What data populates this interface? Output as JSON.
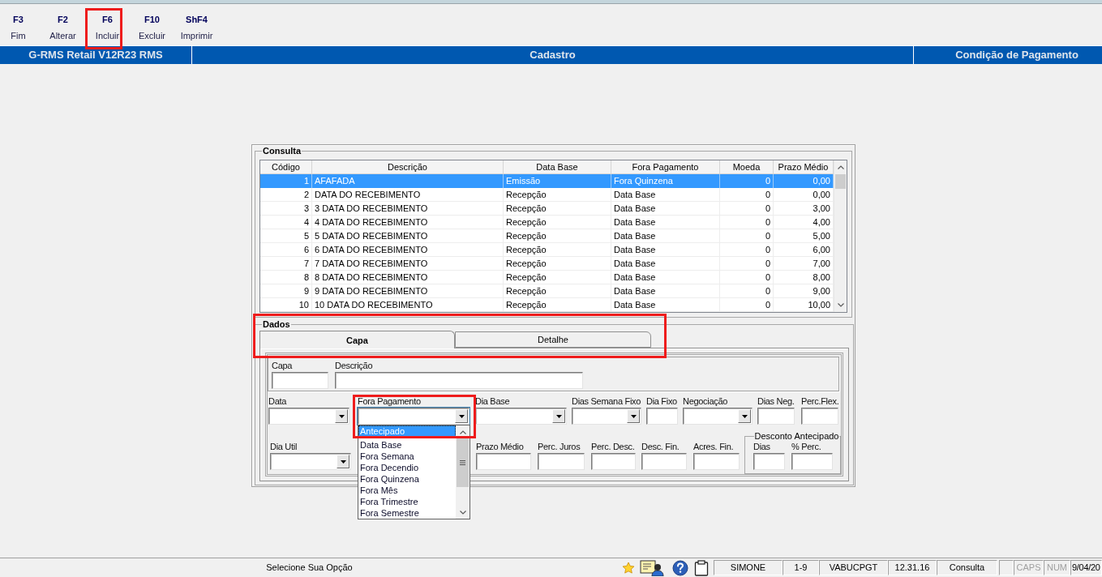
{
  "toolbar": [
    {
      "key": "F3",
      "label": "Fim",
      "highlighted": false
    },
    {
      "key": "F2",
      "label": "Alterar",
      "highlighted": false
    },
    {
      "key": "F6",
      "label": "Incluir",
      "highlighted": true
    },
    {
      "key": "F10",
      "label": "Excluir",
      "highlighted": false
    },
    {
      "key": "ShF4",
      "label": "Imprimir",
      "highlighted": false
    }
  ],
  "header": {
    "app": "G-RMS Retail V12R23 RMS",
    "module": "Cadastro",
    "screen": "Condição de Pagamento"
  },
  "consulta": {
    "title": "Consulta",
    "columns": [
      "Código",
      "Descrição",
      "Data Base",
      "Fora Pagamento",
      "Moeda",
      "Prazo Médio"
    ],
    "rows": [
      {
        "cells": [
          "1",
          "AFAFADA",
          "Emissão",
          "Fora Quinzena",
          "0",
          "0,00"
        ],
        "selected": true
      },
      {
        "cells": [
          "2",
          "DATA DO RECEBIMENTO",
          "Recepção",
          "Data Base",
          "0",
          "0,00"
        ],
        "selected": false
      },
      {
        "cells": [
          "3",
          "3 DATA DO RECEBIMENTO",
          "Recepção",
          "Data Base",
          "0",
          "3,00"
        ],
        "selected": false
      },
      {
        "cells": [
          "4",
          "4 DATA DO RECEBIMENTO",
          "Recepção",
          "Data Base",
          "0",
          "4,00"
        ],
        "selected": false
      },
      {
        "cells": [
          "5",
          "5 DATA DO RECEBIMENTO",
          "Recepção",
          "Data Base",
          "0",
          "5,00"
        ],
        "selected": false
      },
      {
        "cells": [
          "6",
          "6 DATA DO RECEBIMENTO",
          "Recepção",
          "Data Base",
          "0",
          "6,00"
        ],
        "selected": false
      },
      {
        "cells": [
          "7",
          "7 DATA DO RECEBIMENTO",
          "Recepção",
          "Data Base",
          "0",
          "7,00"
        ],
        "selected": false
      },
      {
        "cells": [
          "8",
          "8 DATA DO RECEBIMENTO",
          "Recepção",
          "Data Base",
          "0",
          "8,00"
        ],
        "selected": false
      },
      {
        "cells": [
          "9",
          "9 DATA DO RECEBIMENTO",
          "Recepção",
          "Data Base",
          "0",
          "9,00"
        ],
        "selected": false
      },
      {
        "cells": [
          "10",
          "10 DATA DO RECEBIMENTO",
          "Recepção",
          "Data Base",
          "0",
          "10,00"
        ],
        "selected": false
      }
    ]
  },
  "dados": {
    "title": "Dados",
    "tabs": [
      {
        "label": "Capa",
        "selected": true
      },
      {
        "label": "Detalhe",
        "selected": false
      }
    ],
    "tabs_highlighted": true,
    "capa_fields": [
      {
        "label": "Capa",
        "kind": "text"
      },
      {
        "label": "Descrição",
        "kind": "text"
      }
    ],
    "row_1": [
      {
        "label": "Data",
        "kind": "combo",
        "expanded": false,
        "highlighted": false
      },
      {
        "label": "Fora Pagamento",
        "kind": "combo",
        "expanded": true,
        "highlighted": true,
        "options": [
          {
            "label": "Antecipado",
            "selected": true
          },
          {
            "label": "Data Base",
            "selected": false
          },
          {
            "label": "Fora Semana",
            "selected": false
          },
          {
            "label": "Fora Decendio",
            "selected": false
          },
          {
            "label": "Fora Quinzena",
            "selected": false
          },
          {
            "label": "Fora Mês",
            "selected": false
          },
          {
            "label": "Fora Trimestre",
            "selected": false
          },
          {
            "label": "Fora Semestre",
            "selected": false
          }
        ]
      },
      {
        "label": "Dia Base",
        "kind": "combo",
        "expanded": false,
        "highlighted": false
      },
      {
        "label": "Dias Semana Fixo",
        "kind": "combo",
        "expanded": false,
        "highlighted": false
      },
      {
        "label": "Dia Fixo",
        "kind": "text",
        "highlighted": false
      },
      {
        "label": "Negociação",
        "kind": "combo",
        "expanded": false,
        "highlighted": false
      },
      {
        "label": "Dias Neg.",
        "kind": "text",
        "highlighted": false
      },
      {
        "label": "Perc.Flex.",
        "kind": "text",
        "highlighted": false
      }
    ],
    "row_2": [
      {
        "label": "Dia Util",
        "kind": "combo",
        "expanded": false,
        "highlighted": false
      },
      {
        "label": "Prazo Médio",
        "kind": "text",
        "highlighted": false
      },
      {
        "label": "Perc. Juros",
        "kind": "text",
        "highlighted": false
      },
      {
        "label": "Perc. Desc.",
        "kind": "text",
        "highlighted": false
      },
      {
        "label": "Desc. Fin.",
        "kind": "text",
        "highlighted": false
      },
      {
        "label": "Acres. Fin.",
        "kind": "text",
        "highlighted": false
      }
    ],
    "desconto_antecipado": {
      "title": "Desconto Antecipado",
      "fields": [
        {
          "label": "Dias",
          "kind": "text"
        },
        {
          "label": "% Perc.",
          "kind": "text"
        }
      ]
    }
  },
  "status_bar": {
    "message": "Selecione Sua Opção",
    "panels": [
      "SIMONE",
      "1-9",
      "VABUCPGT",
      "12.31.16",
      "Consulta"
    ],
    "indicators": [
      {
        "text": "CAPS",
        "on": false
      },
      {
        "text": "NUM",
        "on": false
      }
    ],
    "date": "9/04/20"
  }
}
